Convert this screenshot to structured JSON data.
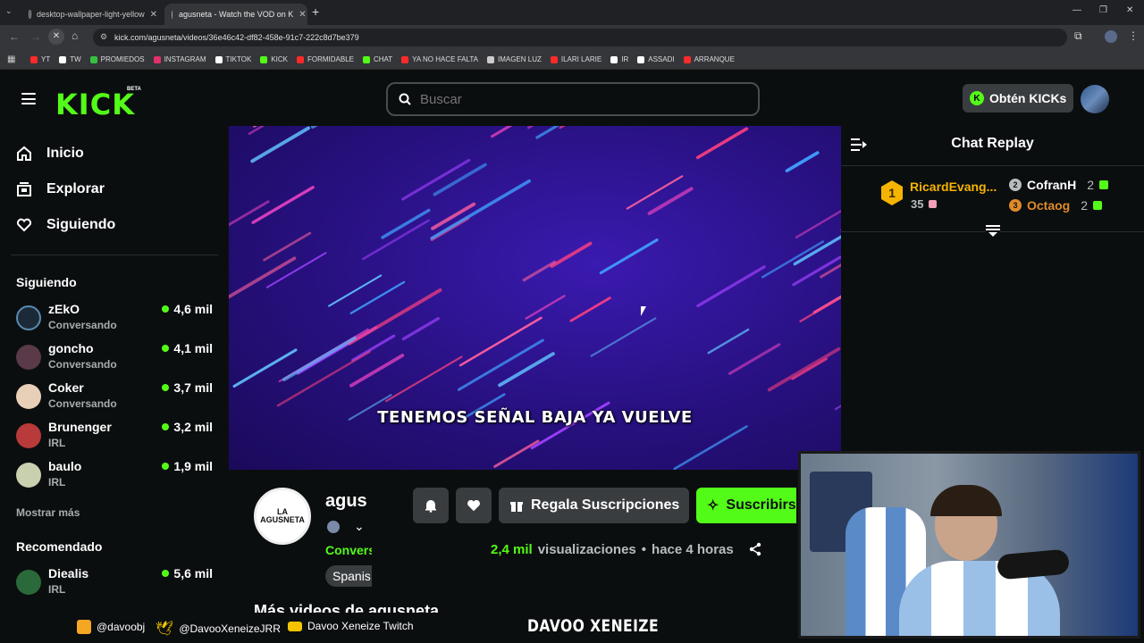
{
  "browser": {
    "tabs": [
      {
        "title": "desktop-wallpaper-light-yellow"
      },
      {
        "title": "agusneta - Watch the VOD on K"
      }
    ],
    "url": "kick.com/agusneta/videos/36e46c42-df82-458e-91c7-222c8d7be379",
    "bookmarks": [
      {
        "label": "YT",
        "color": "#ff2a2a"
      },
      {
        "label": "TW",
        "color": "#ffffff"
      },
      {
        "label": "PROMIEDOS",
        "color": "#35c241"
      },
      {
        "label": "INSTAGRAM",
        "color": "#e1306c"
      },
      {
        "label": "TIKTOK",
        "color": "#ffffff"
      },
      {
        "label": "KICK",
        "color": "#53fc18"
      },
      {
        "label": "FORMIDABLE",
        "color": "#ff2a2a"
      },
      {
        "label": "CHAT",
        "color": "#53fc18"
      },
      {
        "label": "YA NO HACE FALTA",
        "color": "#ff2a2a"
      },
      {
        "label": "IMAGEN LUZ",
        "color": "#cccccc"
      },
      {
        "label": "ILARI LARIE",
        "color": "#ff2a2a"
      },
      {
        "label": "IR",
        "color": "#ffffff"
      },
      {
        "label": "ASSADI",
        "color": "#ffffff"
      },
      {
        "label": "ARRANQUE",
        "color": "#ff2a2a"
      }
    ]
  },
  "header": {
    "logo": "KICK",
    "beta": "BETA",
    "search_placeholder": "Buscar",
    "kicks_label": "Obtén KICKs"
  },
  "nav": [
    {
      "label": "Inicio",
      "icon": "home-icon"
    },
    {
      "label": "Explorar",
      "icon": "browse-icon"
    },
    {
      "label": "Siguiendo",
      "icon": "heart-icon"
    }
  ],
  "following": {
    "title": "Siguiendo",
    "channels": [
      {
        "name": "zEkO",
        "category": "Conversando",
        "viewers": "4,6 mil"
      },
      {
        "name": "goncho",
        "category": "Conversando",
        "viewers": "4,1 mil"
      },
      {
        "name": "Coker",
        "category": "Conversando",
        "viewers": "3,7 mil"
      },
      {
        "name": "Brunenger",
        "category": "IRL",
        "viewers": "3,2 mil"
      },
      {
        "name": "baulo",
        "category": "IRL",
        "viewers": "1,9 mil"
      }
    ],
    "show_more": "Mostrar más"
  },
  "recommended": {
    "title": "Recomendado",
    "channels": [
      {
        "name": "Diealis",
        "category": "IRL",
        "viewers": "5,6 mil"
      }
    ]
  },
  "video": {
    "subtitle": "TENEMOS SEÑAL BAJA YA VUELVE"
  },
  "channel": {
    "name": "agusneta",
    "name_visible": "agus",
    "category_visible": "Convers",
    "language_visible": "Spanis",
    "logo_text": "LA AGUSNETA",
    "gift_label": "Regala Suscripciones",
    "subscribe_label": "Suscribirse",
    "views_count": "2,4 mil",
    "views_label": "visualizaciones",
    "time_ago": "hace 4 horas",
    "more_videos": "Más videos de agusneta"
  },
  "chat": {
    "title": "Chat Replay",
    "gifters": [
      {
        "rank": "1",
        "name": "RicardEvang...",
        "count": "35"
      },
      {
        "rank": "2",
        "name": "CofranH",
        "count": "2"
      },
      {
        "rank": "3",
        "name": "Octaog",
        "count": "2"
      }
    ]
  },
  "overlay": {
    "instagram": "@davoobj",
    "twitter": "@DavooXeneizeJRR",
    "twitch": "Davoo Xeneize Twitch",
    "brand": "DAVOO XENEIZE"
  },
  "colors": {
    "accent": "#53fc18",
    "background": "#0b0e0f",
    "gold": "#f5b400",
    "silver": "#b8bcbe",
    "bronze": "#e08a2a"
  }
}
